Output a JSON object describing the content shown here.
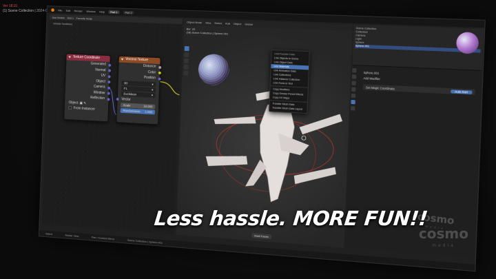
{
  "overlay": {
    "version": "Ver 18.01",
    "scene_line": "(1) Scene Collection | 2024-05-22 17-49-29 (trimmed)",
    "caption": "Less hassle. MORE FUN!!",
    "watermark": "cosmo",
    "watermark_sub": "media"
  },
  "menubar": {
    "items": [
      "File",
      "Edit",
      "Render",
      "Window",
      "Help"
    ],
    "workspaces": [
      "Part 1",
      "Part 2"
    ]
  },
  "node_editor": {
    "header": [
      "Use Nodes",
      "Slot 1",
      "Favorite Node"
    ],
    "breadcrumb": "Shader Nodetree",
    "texcoord": {
      "title": "Texture Coordinate",
      "outputs": [
        "Generated",
        "Normal",
        "UV",
        "Object",
        "Camera",
        "Window",
        "Reflection"
      ],
      "object_label": "Object:",
      "from_instancer": "From Instancer"
    },
    "voronoi": {
      "title": "Voronoi Texture",
      "outputs": [
        "Distance",
        "Color",
        "Position"
      ],
      "dimension": "3D",
      "feature": "F1",
      "metric": "Euclidean",
      "vector_label": "Vector",
      "scale_label": "Scale",
      "scale_value": "19.000",
      "random_label": "Randomness",
      "random_value": "1.000"
    }
  },
  "viewport": {
    "header": [
      "Object Mode",
      "View",
      "Select",
      "Add",
      "Object",
      "Global"
    ],
    "info": [
      "Bsr: 20",
      "(18) Scene Collection | Sphere.001"
    ],
    "context_menu": {
      "title": "Link/Transfer Data",
      "items": [
        "Link Objects to Scene",
        "Link Object Data",
        "Link Materials",
        "Link Animation Data",
        "Link Collections",
        "Link Instance Collection",
        "Link Fonts to Text",
        "Copy Modifiers",
        "Copy Grease Pencil Effects",
        "Copy UV Maps",
        "Transfer Mesh Data",
        "Transfer Mesh Data Layout"
      ],
      "selected_index": 2
    },
    "mode_pill": "Inset Faces"
  },
  "right_panel": {
    "outliner": [
      "Scene Collection",
      "Collection",
      "Camera",
      "Light",
      "Sphere",
      "Sphere.001"
    ],
    "outliner_selected": 5,
    "props_title": "Sphere.001",
    "add_modifier": "Add Modifier",
    "modifier_name": "Set Magic Coordinate",
    "modifier_btn": "Auto Sort"
  },
  "statusbar": [
    "Select",
    "Rotate View",
    "Pan / Context Menu",
    "Scene Collection | Sphere.001"
  ]
}
